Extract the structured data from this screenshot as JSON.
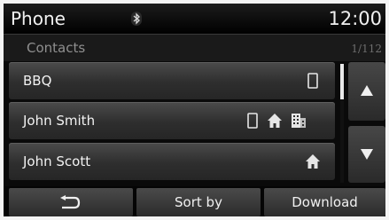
{
  "status_bar": {
    "app_title": "Phone",
    "bluetooth_icon": "bluetooth-icon",
    "clock": "12:00"
  },
  "header": {
    "section": "Contacts",
    "page_indicator": "1/112"
  },
  "contacts": [
    {
      "name": "BBQ",
      "icons": [
        "mobile-phone-icon"
      ]
    },
    {
      "name": "John Smith",
      "icons": [
        "mobile-phone-icon",
        "home-icon",
        "office-icon"
      ]
    },
    {
      "name": "John Scott",
      "icons": [
        "home-icon"
      ]
    }
  ],
  "scroll": {
    "up_icon": "triangle-up-icon",
    "down_icon": "triangle-down-icon"
  },
  "bottom_bar": {
    "back_icon": "back-arrow-icon",
    "sort_label": "Sort by",
    "download_label": "Download"
  },
  "colors": {
    "background": "#0a0a0a",
    "row": "#3a3a3a",
    "text": "#f2f2f2",
    "muted": "#8f8f8f"
  }
}
